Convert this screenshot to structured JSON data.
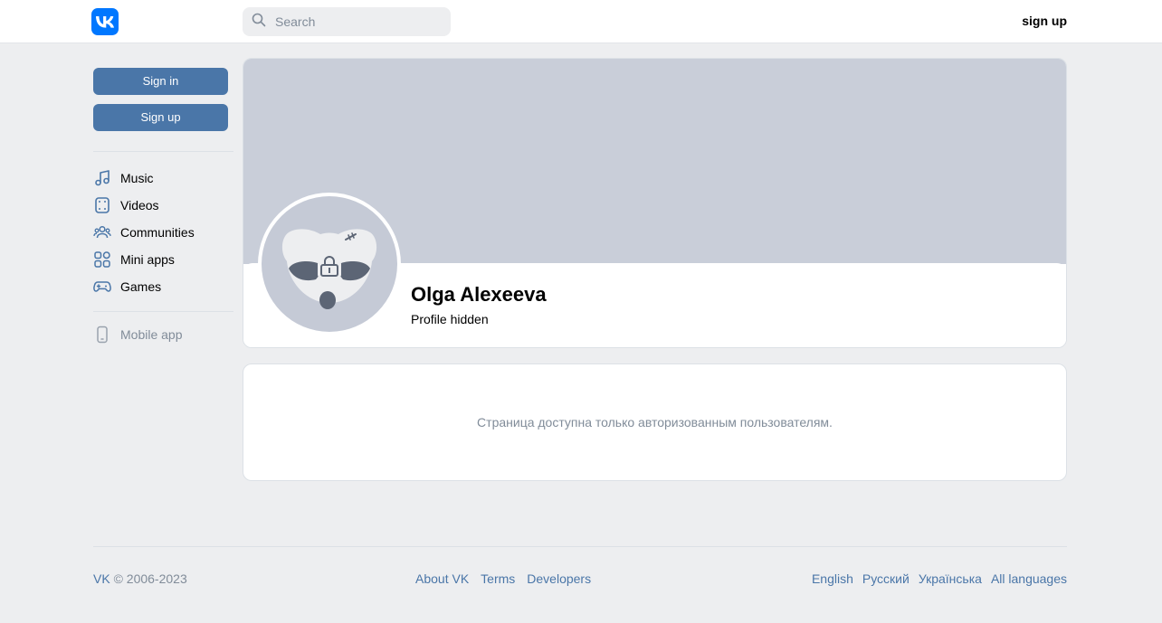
{
  "header": {
    "logo_text": "VK",
    "search_placeholder": "Search",
    "signup_label": "sign up"
  },
  "sidebar": {
    "signin_label": "Sign in",
    "signup_label": "Sign up",
    "items": [
      {
        "label": "Music",
        "icon": "music-icon"
      },
      {
        "label": "Videos",
        "icon": "video-icon"
      },
      {
        "label": "Communities",
        "icon": "communities-icon"
      },
      {
        "label": "Mini apps",
        "icon": "mini-apps-icon"
      },
      {
        "label": "Games",
        "icon": "gamepad-icon"
      }
    ],
    "mobile_label": "Mobile app"
  },
  "profile": {
    "name": "Olga Alexeeva",
    "status": "Profile hidden"
  },
  "notice": {
    "text": "Страница доступна только авторизованным пользователям."
  },
  "footer": {
    "brand": "VK",
    "copyright": "© 2006-2023",
    "links": [
      "About VK",
      "Terms",
      "Developers"
    ],
    "languages": [
      "English",
      "Русский",
      "Українська",
      "All languages"
    ]
  },
  "colors": {
    "brand": "#0077ff",
    "button": "#4a76a8",
    "background": "#edeef0",
    "cover": "#c9ced9",
    "muted": "#818c99"
  }
}
